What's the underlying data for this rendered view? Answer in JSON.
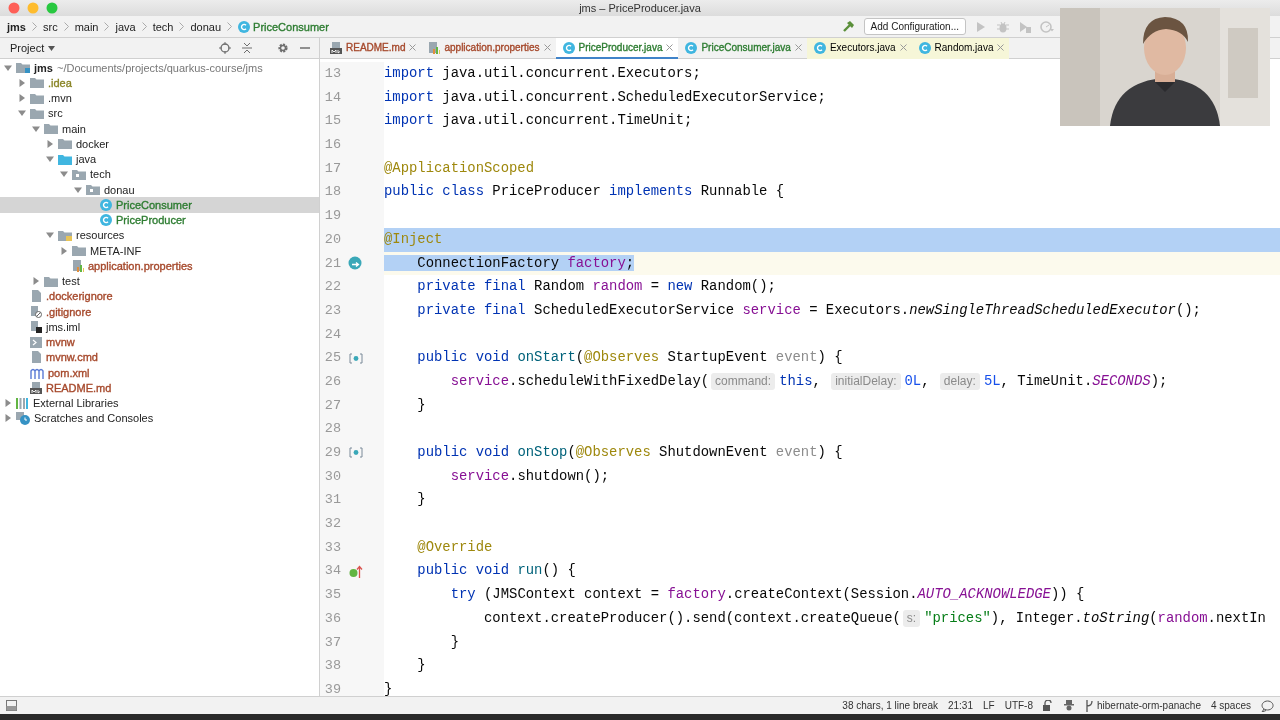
{
  "window": {
    "title": "jms – PriceProducer.java"
  },
  "breadcrumbs": [
    {
      "label": "jms",
      "kind": "project"
    },
    {
      "label": "src",
      "kind": "plain"
    },
    {
      "label": "main",
      "kind": "plain"
    },
    {
      "label": "java",
      "kind": "plain"
    },
    {
      "label": "tech",
      "kind": "plain"
    },
    {
      "label": "donau",
      "kind": "plain"
    },
    {
      "label": "PriceConsumer",
      "kind": "class",
      "color": "#2e7d32"
    }
  ],
  "toolbar": {
    "run_configuration": "Add Configuration...",
    "actions": [
      {
        "kind": "build",
        "disabled": false
      },
      {
        "kind": "run",
        "disabled": true
      },
      {
        "kind": "debug",
        "disabled": true
      },
      {
        "kind": "coverage",
        "disabled": true
      },
      {
        "kind": "profile",
        "disabled": true
      }
    ]
  },
  "project_panel": {
    "title": "Project",
    "tree": [
      {
        "label": "jms",
        "path": "~/Documents/projects/quarkus-course/jms",
        "kind": "module",
        "expanded": true,
        "selected": false,
        "children": [
          {
            "label": ".idea",
            "kind": "folder",
            "color": "#8a8526",
            "expanded": false,
            "selected": false
          },
          {
            "label": ".mvn",
            "kind": "folder",
            "expanded": false,
            "selected": false
          },
          {
            "label": "src",
            "kind": "folder",
            "expanded": true,
            "selected": false,
            "children": [
              {
                "label": "main",
                "kind": "folder",
                "expanded": true,
                "selected": false,
                "children": [
                  {
                    "label": "docker",
                    "kind": "folder",
                    "expanded": false,
                    "selected": false
                  },
                  {
                    "label": "java",
                    "kind": "source",
                    "expanded": true,
                    "selected": false,
                    "children": [
                      {
                        "label": "tech",
                        "kind": "package",
                        "expanded": true,
                        "selected": false,
                        "children": [
                          {
                            "label": "donau",
                            "kind": "package",
                            "expanded": true,
                            "selected": false,
                            "children": [
                              {
                                "label": "PriceConsumer",
                                "kind": "class",
                                "color": "#2e7d32",
                                "selected": true
                              },
                              {
                                "label": "PriceProducer",
                                "kind": "class",
                                "color": "#2e7d32",
                                "selected": false
                              }
                            ]
                          }
                        ]
                      }
                    ]
                  },
                  {
                    "label": "resources",
                    "kind": "resources",
                    "expanded": true,
                    "selected": false,
                    "children": [
                      {
                        "label": "META-INF",
                        "kind": "folder",
                        "expanded": false,
                        "selected": false
                      },
                      {
                        "label": "application.properties",
                        "kind": "properties",
                        "color": "#a6492c",
                        "selected": false
                      }
                    ]
                  }
                ]
              },
              {
                "label": "test",
                "kind": "folder",
                "expanded": false,
                "selected": false
              }
            ]
          },
          {
            "label": ".dockerignore",
            "kind": "file",
            "color": "#a6492c",
            "selected": false
          },
          {
            "label": ".gitignore",
            "kind": "gitignore",
            "color": "#a6492c",
            "selected": false
          },
          {
            "label": "jms.iml",
            "kind": "iml",
            "selected": false
          },
          {
            "label": "mvnw",
            "kind": "script",
            "color": "#a6492c",
            "selected": false
          },
          {
            "label": "mvnw.cmd",
            "kind": "file",
            "color": "#a6492c",
            "selected": false
          },
          {
            "label": "pom.xml",
            "kind": "maven",
            "color": "#a6492c",
            "selected": false
          },
          {
            "label": "README.md",
            "kind": "markdown",
            "color": "#a6492c",
            "selected": false
          }
        ]
      },
      {
        "label": "External Libraries",
        "kind": "libraries",
        "expanded": false,
        "selected": false
      },
      {
        "label": "Scratches and Consoles",
        "kind": "scratches",
        "expanded": false,
        "selected": false
      }
    ]
  },
  "editor_tabs": [
    {
      "label": "README.md",
      "kind": "markdown",
      "color": "#a6492c",
      "selected": false,
      "library": false
    },
    {
      "label": "application.properties",
      "kind": "properties",
      "color": "#a6492c",
      "selected": false,
      "library": false
    },
    {
      "label": "PriceProducer.java",
      "kind": "class",
      "color": "#2e7d32",
      "selected": true,
      "library": false
    },
    {
      "label": "PriceConsumer.java",
      "kind": "class",
      "color": "#2e7d32",
      "selected": false,
      "library": false
    },
    {
      "label": "Executors.java",
      "kind": "class",
      "selected": false,
      "library": true
    },
    {
      "label": "Random.java",
      "kind": "class",
      "selected": false,
      "library": true
    }
  ],
  "editor": {
    "lines": [
      {
        "number": "13",
        "tokens": [
          {
            "kind": "kw",
            "text": "import"
          },
          {
            "kind": "plain",
            "text": " java.util.concurrent.Executors;"
          }
        ]
      },
      {
        "number": "14",
        "tokens": [
          {
            "kind": "kw",
            "text": "import"
          },
          {
            "kind": "plain",
            "text": " java.util.concurrent.ScheduledExecutorService;"
          }
        ]
      },
      {
        "number": "15",
        "tokens": [
          {
            "kind": "kw",
            "text": "import"
          },
          {
            "kind": "plain",
            "text": " java.util.concurrent.TimeUnit;"
          }
        ]
      },
      {
        "number": "16"
      },
      {
        "number": "17",
        "tokens": [
          {
            "kind": "ann",
            "text": "@ApplicationScoped"
          }
        ]
      },
      {
        "number": "18",
        "tokens": [
          {
            "kind": "kw",
            "text": "public class"
          },
          {
            "kind": "plain",
            "text": " PriceProducer "
          },
          {
            "kind": "kw",
            "text": "implements"
          },
          {
            "kind": "plain",
            "text": " Runnable {"
          }
        ]
      },
      {
        "number": "19"
      },
      {
        "number": "20",
        "selected": true,
        "tokens": [
          {
            "kind": "ann",
            "text": "    @Inject"
          }
        ]
      },
      {
        "number": "21",
        "selected": true,
        "current": true,
        "gutter": {
          "kind": "bean"
        },
        "tokens": [
          {
            "kind": "plain",
            "text": "    ConnectionFactory "
          },
          {
            "kind": "field",
            "text": "factory"
          },
          {
            "kind": "plain",
            "text": ";"
          }
        ]
      },
      {
        "number": "22",
        "tokens": [
          {
            "kind": "kw",
            "text": "    private final"
          },
          {
            "kind": "plain",
            "text": " Random "
          },
          {
            "kind": "field",
            "text": "random"
          },
          {
            "kind": "plain",
            "text": " = "
          },
          {
            "kind": "kw",
            "text": "new"
          },
          {
            "kind": "plain",
            "text": " Random();"
          }
        ]
      },
      {
        "number": "23",
        "tokens": [
          {
            "kind": "kw",
            "text": "    private final"
          },
          {
            "kind": "plain",
            "text": " ScheduledExecutorService "
          },
          {
            "kind": "field",
            "text": "service"
          },
          {
            "kind": "plain",
            "text": " = Executors."
          },
          {
            "kind": "italic",
            "text": "newSingleThreadScheduledExecutor"
          },
          {
            "kind": "plain",
            "text": "();"
          }
        ]
      },
      {
        "number": "24"
      },
      {
        "number": "25",
        "gutter": {
          "kind": "observer"
        },
        "tokens": [
          {
            "kind": "kw",
            "text": "    public void "
          },
          {
            "kind": "decl",
            "text": "onStart"
          },
          {
            "kind": "plain",
            "text": "("
          },
          {
            "kind": "ann",
            "text": "@Observes"
          },
          {
            "kind": "plain",
            "text": " StartupEvent "
          },
          {
            "kind": "unused",
            "text": "event"
          },
          {
            "kind": "plain",
            "text": ") {"
          }
        ]
      },
      {
        "number": "26",
        "tokens": [
          {
            "kind": "field",
            "text": "        service"
          },
          {
            "kind": "plain",
            "text": ".scheduleWithFixedDelay("
          },
          {
            "kind": "hint",
            "text": "command:"
          },
          {
            "kind": "kw",
            "text": "this"
          },
          {
            "kind": "plain",
            "text": ", "
          },
          {
            "kind": "hint",
            "text": "initialDelay:"
          },
          {
            "kind": "num",
            "text": "0L"
          },
          {
            "kind": "plain",
            "text": ", "
          },
          {
            "kind": "hint",
            "text": "delay:"
          },
          {
            "kind": "num",
            "text": "5L"
          },
          {
            "kind": "plain",
            "text": ", TimeUnit."
          },
          {
            "kind": "static",
            "text": "SECONDS"
          },
          {
            "kind": "plain",
            "text": ");"
          }
        ]
      },
      {
        "number": "27",
        "tokens": [
          {
            "kind": "plain",
            "text": "    }"
          }
        ]
      },
      {
        "number": "28"
      },
      {
        "number": "29",
        "gutter": {
          "kind": "observer"
        },
        "tokens": [
          {
            "kind": "kw",
            "text": "    public void "
          },
          {
            "kind": "decl",
            "text": "onStop"
          },
          {
            "kind": "plain",
            "text": "("
          },
          {
            "kind": "ann",
            "text": "@Observes"
          },
          {
            "kind": "plain",
            "text": " ShutdownEvent "
          },
          {
            "kind": "unused",
            "text": "event"
          },
          {
            "kind": "plain",
            "text": ") {"
          }
        ]
      },
      {
        "number": "30",
        "tokens": [
          {
            "kind": "field",
            "text": "        service"
          },
          {
            "kind": "plain",
            "text": ".shutdown();"
          }
        ]
      },
      {
        "number": "31",
        "tokens": [
          {
            "kind": "plain",
            "text": "    }"
          }
        ]
      },
      {
        "number": "32"
      },
      {
        "number": "33",
        "tokens": [
          {
            "kind": "ann",
            "text": "    @Override"
          }
        ]
      },
      {
        "number": "34",
        "gutter": {
          "kind": "implements"
        },
        "tokens": [
          {
            "kind": "kw",
            "text": "    public void "
          },
          {
            "kind": "decl",
            "text": "run"
          },
          {
            "kind": "plain",
            "text": "() {"
          }
        ]
      },
      {
        "number": "35",
        "tokens": [
          {
            "kind": "kw",
            "text": "        try"
          },
          {
            "kind": "plain",
            "text": " (JMSContext context = "
          },
          {
            "kind": "field",
            "text": "factory"
          },
          {
            "kind": "plain",
            "text": ".createContext(Session."
          },
          {
            "kind": "static",
            "text": "AUTO_ACKNOWLEDGE"
          },
          {
            "kind": "plain",
            "text": ")) {"
          }
        ]
      },
      {
        "number": "36",
        "tokens": [
          {
            "kind": "plain",
            "text": "            context.createProducer().send(context.createQueue("
          },
          {
            "kind": "hint",
            "text": "s:"
          },
          {
            "kind": "str",
            "text": "\"prices\""
          },
          {
            "kind": "plain",
            "text": "), Integer."
          },
          {
            "kind": "italic",
            "text": "toString"
          },
          {
            "kind": "plain",
            "text": "("
          },
          {
            "kind": "field",
            "text": "random"
          },
          {
            "kind": "plain",
            "text": ".nextIn"
          }
        ]
      },
      {
        "number": "37",
        "tokens": [
          {
            "kind": "plain",
            "text": "        }"
          }
        ]
      },
      {
        "number": "38",
        "tokens": [
          {
            "kind": "plain",
            "text": "    }"
          }
        ]
      },
      {
        "number": "39",
        "tokens": [
          {
            "kind": "plain",
            "text": "}"
          }
        ]
      }
    ]
  },
  "status_bar": {
    "selection_info": "38 chars, 1 line break",
    "position": "21:31",
    "line_separator": "LF",
    "encoding": "UTF-8",
    "branch": "hibernate-orm-panache",
    "indent": "4 spaces"
  }
}
